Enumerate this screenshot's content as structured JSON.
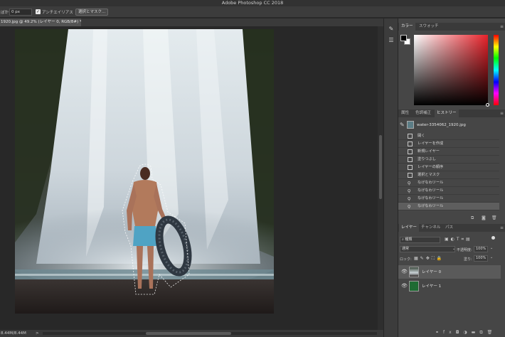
{
  "app": {
    "title": "Adobe Photoshop CC 2018"
  },
  "options_bar": {
    "feather_label": "ぼかし:",
    "feather_value": "0 px",
    "antialias_checked": true,
    "antialias_label": "アンチエイリアス",
    "select_mask_button": "選択とマスク..."
  },
  "document": {
    "tab_title": "1920.jpg @ 49.2% (レイヤー 0, RGB/8#) *",
    "status_text": "8.44M/8.44M",
    "status_arrow": ">"
  },
  "tools": [
    {
      "name": "brush-settings-icon",
      "glyph": "✎"
    },
    {
      "name": "adjust-sliders-icon",
      "glyph": "☰"
    }
  ],
  "color_panel": {
    "tabs": [
      "カラー",
      "スウォッチ"
    ],
    "foreground": "#000000",
    "background": "#ffffff"
  },
  "history_panel": {
    "tabs": [
      "属性",
      "色調補正",
      "ヒストリー"
    ],
    "snapshot_name": "water-3354062_1920.jpg",
    "items": [
      {
        "label": "開く",
        "icon": "doc"
      },
      {
        "label": "レイヤーを作成",
        "icon": "doc"
      },
      {
        "label": "新規レイヤー",
        "icon": "doc"
      },
      {
        "label": "塗りつぶし",
        "icon": "doc"
      },
      {
        "label": "レイヤーの順序",
        "icon": "doc"
      },
      {
        "label": "選択とマスク",
        "icon": "doc"
      },
      {
        "label": "なげなわツール",
        "icon": "lasso"
      },
      {
        "label": "なげなわツール",
        "icon": "lasso"
      },
      {
        "label": "なげなわツール",
        "icon": "lasso"
      },
      {
        "label": "なげなわツール",
        "icon": "lasso"
      }
    ],
    "selected_index": 9
  },
  "layers_panel": {
    "tabs": [
      "レイヤー",
      "チャンネル",
      "パス"
    ],
    "filter_kind": "種類",
    "blend_mode": "通常",
    "opacity_label": "不透明度:",
    "opacity_value": "100%",
    "lock_label": "ロック:",
    "fill_label": "塗り:",
    "fill_value": "100%",
    "layers": [
      {
        "name": "レイヤー 0",
        "thumb": "photo",
        "visible": true,
        "selected": true
      },
      {
        "name": "レイヤー 1",
        "thumb_color": "#1f6b33",
        "visible": true,
        "selected": false
      }
    ]
  }
}
